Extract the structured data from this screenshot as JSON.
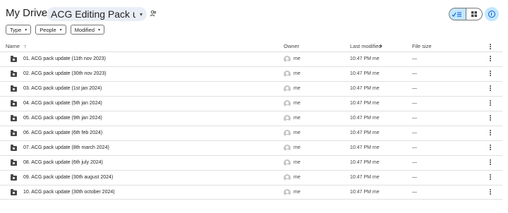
{
  "breadcrumb": {
    "root": "My Drive",
    "separator": "›",
    "current": "ACG Editing Pack updat...",
    "current_caret": "▾"
  },
  "filters": [
    {
      "label": "Type",
      "caret": "▾"
    },
    {
      "label": "People",
      "caret": "▾"
    },
    {
      "label": "Modified",
      "caret": "▾"
    }
  ],
  "view_toggle": {
    "list_icon": "check-list-icon",
    "grid_icon": "grid-icon",
    "active": "list"
  },
  "info_icon": "info-icon",
  "table": {
    "columns": {
      "name": "Name",
      "sort_arrow": "↑",
      "owner": "Owner",
      "modified": "Last modified",
      "modified_sort": "▾",
      "size": "File size"
    },
    "rows": [
      {
        "name": "01. ACG pack update (11th nov 2023)",
        "owner": "me",
        "modified": "10:47 PM me",
        "size": "—"
      },
      {
        "name": "02. ACG pack update (30th nov 2023)",
        "owner": "me",
        "modified": "10:47 PM me",
        "size": "—"
      },
      {
        "name": "03. ACG pack update (1st jan 2024)",
        "owner": "me",
        "modified": "10:47 PM me",
        "size": "—"
      },
      {
        "name": "04. ACG pack update (5th jan 2024)",
        "owner": "me",
        "modified": "10:47 PM me",
        "size": "—"
      },
      {
        "name": "05. ACG pack update (9th jan 2024)",
        "owner": "me",
        "modified": "10:47 PM me",
        "size": "—"
      },
      {
        "name": "06. ACG pack update (6th feb 2024)",
        "owner": "me",
        "modified": "10:47 PM me",
        "size": "—"
      },
      {
        "name": "07. ACG pack update (8th march 2024)",
        "owner": "me",
        "modified": "10:47 PM me",
        "size": "—"
      },
      {
        "name": "08. ACG pack update (6th july 2024)",
        "owner": "me",
        "modified": "10:47 PM me",
        "size": "—"
      },
      {
        "name": "09. ACG pack update (30th august 2024)",
        "owner": "me",
        "modified": "10:47 PM me",
        "size": "—"
      },
      {
        "name": "10. ACG pack update (30th october 2024)",
        "owner": "me",
        "modified": "10:47 PM me",
        "size": "—"
      }
    ]
  },
  "colors": {
    "accent": "#c2e7ff",
    "accent_dark": "#0b57d0",
    "chip_bg": "#e9eef6",
    "divider": "#e0e0e0"
  }
}
